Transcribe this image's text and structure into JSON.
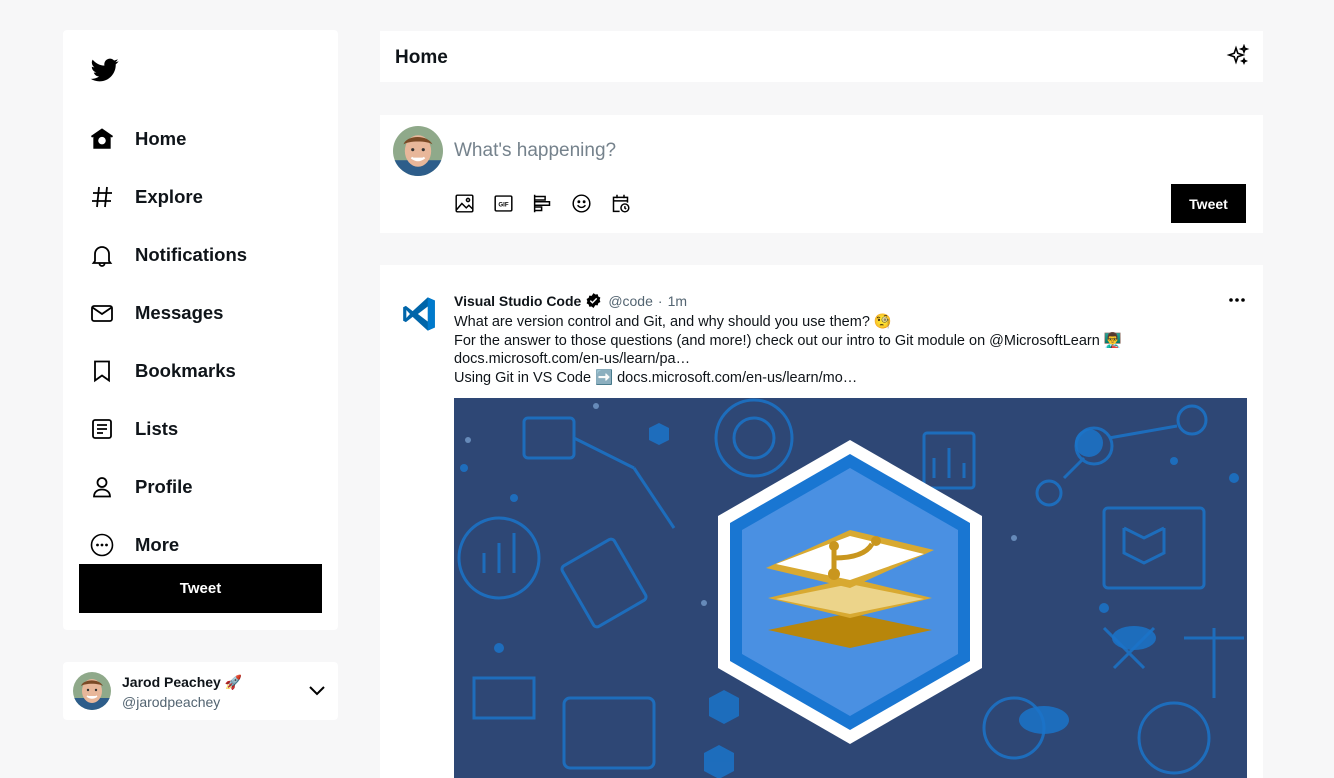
{
  "nav": {
    "items": [
      {
        "label": "Home",
        "icon": "home-icon"
      },
      {
        "label": "Explore",
        "icon": "hashtag-icon"
      },
      {
        "label": "Notifications",
        "icon": "bell-icon"
      },
      {
        "label": "Messages",
        "icon": "envelope-icon"
      },
      {
        "label": "Bookmarks",
        "icon": "bookmark-icon"
      },
      {
        "label": "Lists",
        "icon": "list-icon"
      },
      {
        "label": "Profile",
        "icon": "person-icon"
      },
      {
        "label": "More",
        "icon": "more-circle-icon"
      }
    ],
    "tweet_label": "Tweet"
  },
  "account": {
    "name": "Jarod Peachey 🚀",
    "handle": "@jarodpeachey"
  },
  "header": {
    "title": "Home"
  },
  "compose": {
    "placeholder": "What's happening?",
    "tweet_label": "Tweet",
    "tools": [
      "image-icon",
      "gif-icon",
      "poll-icon",
      "emoji-icon",
      "schedule-icon"
    ]
  },
  "tweet": {
    "author_name": "Visual Studio Code",
    "handle": "@code",
    "separator": "·",
    "time": "1m",
    "lines": [
      "What are version control and Git, and why should you use them? 🧐",
      "For the answer to those questions (and more!) check out our intro to Git module on @MicrosoftLearn 👨‍🏫",
      "docs.microsoft.com/en-us/learn/pa…",
      "Using Git in VS Code ➡️ docs.microsoft.com/en-us/learn/mo…"
    ]
  },
  "colors": {
    "brand_black": "#000000",
    "vscode_blue": "#0078d4",
    "media_bg": "#2e4775"
  }
}
